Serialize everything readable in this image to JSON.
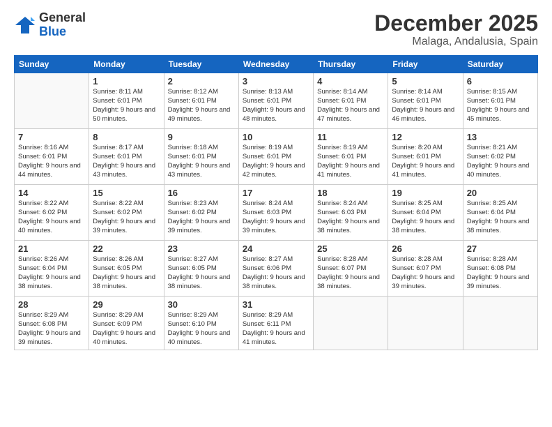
{
  "logo": {
    "general": "General",
    "blue": "Blue"
  },
  "title": "December 2025",
  "subtitle": "Malaga, Andalusia, Spain",
  "days_of_week": [
    "Sunday",
    "Monday",
    "Tuesday",
    "Wednesday",
    "Thursday",
    "Friday",
    "Saturday"
  ],
  "weeks": [
    [
      {
        "day": "",
        "info": ""
      },
      {
        "day": "1",
        "info": "Sunrise: 8:11 AM\nSunset: 6:01 PM\nDaylight: 9 hours\nand 50 minutes."
      },
      {
        "day": "2",
        "info": "Sunrise: 8:12 AM\nSunset: 6:01 PM\nDaylight: 9 hours\nand 49 minutes."
      },
      {
        "day": "3",
        "info": "Sunrise: 8:13 AM\nSunset: 6:01 PM\nDaylight: 9 hours\nand 48 minutes."
      },
      {
        "day": "4",
        "info": "Sunrise: 8:14 AM\nSunset: 6:01 PM\nDaylight: 9 hours\nand 47 minutes."
      },
      {
        "day": "5",
        "info": "Sunrise: 8:14 AM\nSunset: 6:01 PM\nDaylight: 9 hours\nand 46 minutes."
      },
      {
        "day": "6",
        "info": "Sunrise: 8:15 AM\nSunset: 6:01 PM\nDaylight: 9 hours\nand 45 minutes."
      }
    ],
    [
      {
        "day": "7",
        "info": "Sunrise: 8:16 AM\nSunset: 6:01 PM\nDaylight: 9 hours\nand 44 minutes."
      },
      {
        "day": "8",
        "info": "Sunrise: 8:17 AM\nSunset: 6:01 PM\nDaylight: 9 hours\nand 43 minutes."
      },
      {
        "day": "9",
        "info": "Sunrise: 8:18 AM\nSunset: 6:01 PM\nDaylight: 9 hours\nand 43 minutes."
      },
      {
        "day": "10",
        "info": "Sunrise: 8:19 AM\nSunset: 6:01 PM\nDaylight: 9 hours\nand 42 minutes."
      },
      {
        "day": "11",
        "info": "Sunrise: 8:19 AM\nSunset: 6:01 PM\nDaylight: 9 hours\nand 41 minutes."
      },
      {
        "day": "12",
        "info": "Sunrise: 8:20 AM\nSunset: 6:01 PM\nDaylight: 9 hours\nand 41 minutes."
      },
      {
        "day": "13",
        "info": "Sunrise: 8:21 AM\nSunset: 6:02 PM\nDaylight: 9 hours\nand 40 minutes."
      }
    ],
    [
      {
        "day": "14",
        "info": "Sunrise: 8:22 AM\nSunset: 6:02 PM\nDaylight: 9 hours\nand 40 minutes."
      },
      {
        "day": "15",
        "info": "Sunrise: 8:22 AM\nSunset: 6:02 PM\nDaylight: 9 hours\nand 39 minutes."
      },
      {
        "day": "16",
        "info": "Sunrise: 8:23 AM\nSunset: 6:02 PM\nDaylight: 9 hours\nand 39 minutes."
      },
      {
        "day": "17",
        "info": "Sunrise: 8:24 AM\nSunset: 6:03 PM\nDaylight: 9 hours\nand 39 minutes."
      },
      {
        "day": "18",
        "info": "Sunrise: 8:24 AM\nSunset: 6:03 PM\nDaylight: 9 hours\nand 38 minutes."
      },
      {
        "day": "19",
        "info": "Sunrise: 8:25 AM\nSunset: 6:04 PM\nDaylight: 9 hours\nand 38 minutes."
      },
      {
        "day": "20",
        "info": "Sunrise: 8:25 AM\nSunset: 6:04 PM\nDaylight: 9 hours\nand 38 minutes."
      }
    ],
    [
      {
        "day": "21",
        "info": "Sunrise: 8:26 AM\nSunset: 6:04 PM\nDaylight: 9 hours\nand 38 minutes."
      },
      {
        "day": "22",
        "info": "Sunrise: 8:26 AM\nSunset: 6:05 PM\nDaylight: 9 hours\nand 38 minutes."
      },
      {
        "day": "23",
        "info": "Sunrise: 8:27 AM\nSunset: 6:05 PM\nDaylight: 9 hours\nand 38 minutes."
      },
      {
        "day": "24",
        "info": "Sunrise: 8:27 AM\nSunset: 6:06 PM\nDaylight: 9 hours\nand 38 minutes."
      },
      {
        "day": "25",
        "info": "Sunrise: 8:28 AM\nSunset: 6:07 PM\nDaylight: 9 hours\nand 38 minutes."
      },
      {
        "day": "26",
        "info": "Sunrise: 8:28 AM\nSunset: 6:07 PM\nDaylight: 9 hours\nand 39 minutes."
      },
      {
        "day": "27",
        "info": "Sunrise: 8:28 AM\nSunset: 6:08 PM\nDaylight: 9 hours\nand 39 minutes."
      }
    ],
    [
      {
        "day": "28",
        "info": "Sunrise: 8:29 AM\nSunset: 6:08 PM\nDaylight: 9 hours\nand 39 minutes."
      },
      {
        "day": "29",
        "info": "Sunrise: 8:29 AM\nSunset: 6:09 PM\nDaylight: 9 hours\nand 40 minutes."
      },
      {
        "day": "30",
        "info": "Sunrise: 8:29 AM\nSunset: 6:10 PM\nDaylight: 9 hours\nand 40 minutes."
      },
      {
        "day": "31",
        "info": "Sunrise: 8:29 AM\nSunset: 6:11 PM\nDaylight: 9 hours\nand 41 minutes."
      },
      {
        "day": "",
        "info": ""
      },
      {
        "day": "",
        "info": ""
      },
      {
        "day": "",
        "info": ""
      }
    ]
  ]
}
